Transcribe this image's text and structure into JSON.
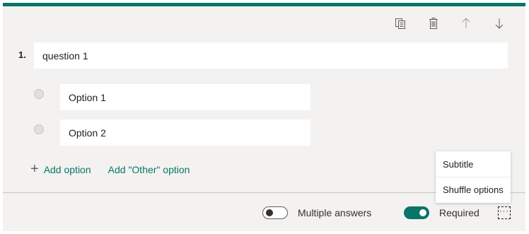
{
  "question": {
    "number": "1.",
    "title": "question 1",
    "options": [
      {
        "label": "Option 1"
      },
      {
        "label": "Option 2"
      }
    ],
    "add_option_label": "Add option",
    "add_other_label": "Add \"Other\" option"
  },
  "toolbar": {
    "icons": [
      "copy-icon",
      "delete-icon",
      "move-up-icon",
      "move-down-icon"
    ]
  },
  "footer": {
    "multiple_answers_label": "Multiple answers",
    "multiple_answers_on": false,
    "required_label": "Required",
    "required_on": true,
    "more_icon": "ellipsis-icon"
  },
  "menu": {
    "items": [
      "Subtitle",
      "Shuffle options"
    ]
  },
  "colors": {
    "accent": "#077568",
    "card_bg": "#f3f2f1",
    "field_bg": "#ffffff"
  }
}
